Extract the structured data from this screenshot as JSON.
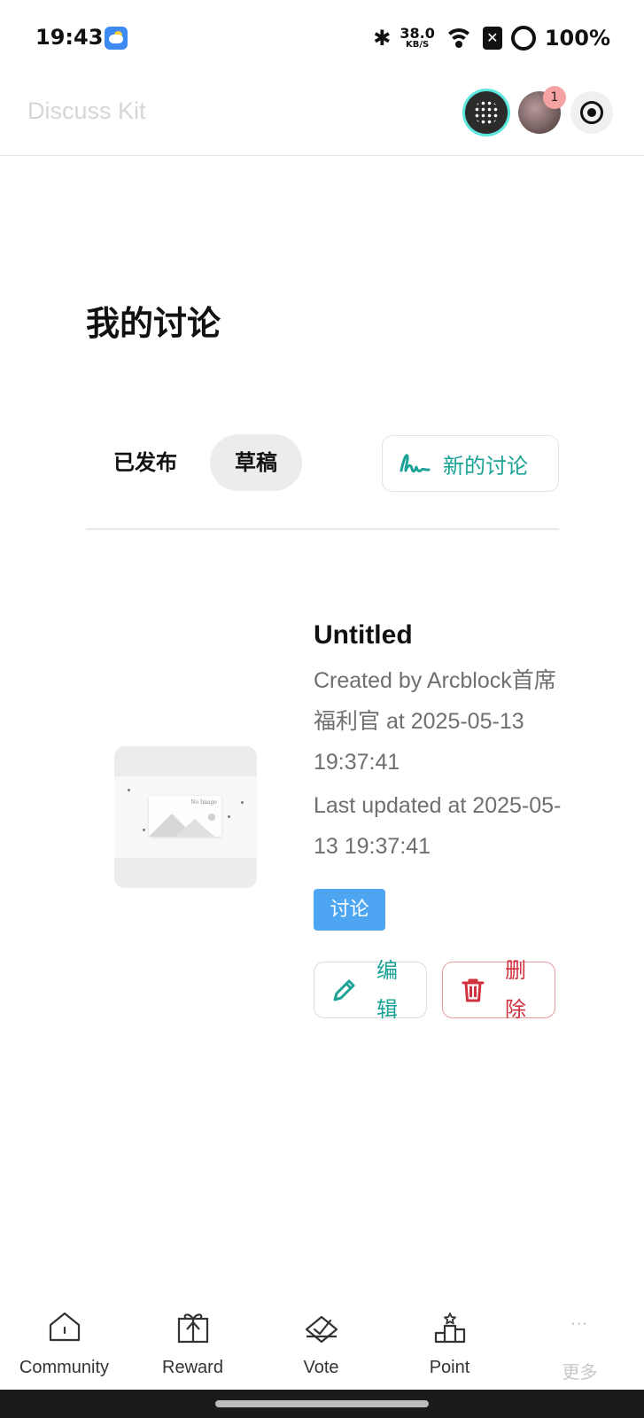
{
  "status_bar": {
    "time": "19:43",
    "net_speed_value": "38.0",
    "net_speed_unit": "KB/S",
    "sim_icon": "sim-x-icon",
    "battery": "100%"
  },
  "header": {
    "brand": "Discuss Kit",
    "notification_count": "1"
  },
  "page": {
    "title": "我的讨论",
    "tabs": [
      {
        "label": "已发布",
        "active": false
      },
      {
        "label": "草稿",
        "active": true
      }
    ],
    "new_discussion_label": "新的讨论"
  },
  "discussion": {
    "thumbnail_text": "No Image",
    "title": "Untitled",
    "created": "Created by Arcblock首席福利官 at 2025-05-13 19:37:41",
    "updated": "Last updated at 2025-05-13 19:37:41",
    "tag": "讨论",
    "edit_label": "编辑",
    "delete_label": "删除"
  },
  "bottom_nav": {
    "items": [
      {
        "label": "Community",
        "icon": "home-icon"
      },
      {
        "label": "Reward",
        "icon": "gift-icon"
      },
      {
        "label": "Vote",
        "icon": "vote-icon"
      },
      {
        "label": "Point",
        "icon": "podium-icon"
      },
      {
        "label": "更多",
        "icon": "more-icon"
      }
    ]
  },
  "colors": {
    "accent": "#1aa396",
    "danger": "#d1313d",
    "tag": "#4ea6f2"
  }
}
